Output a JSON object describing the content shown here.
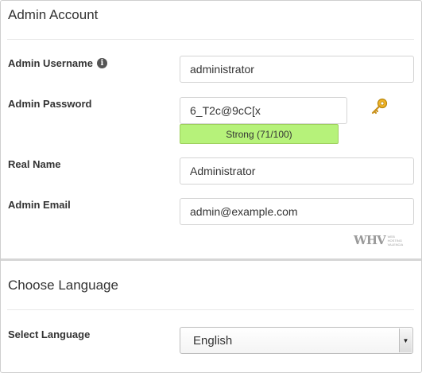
{
  "admin_section": {
    "title": "Admin Account",
    "username": {
      "label": "Admin Username",
      "value": "administrator"
    },
    "password": {
      "label": "Admin Password",
      "value": "6_T2c@9cC[x",
      "strength": "Strong (71/100)",
      "strength_color": "#b6f27a"
    },
    "real_name": {
      "label": "Real Name",
      "value": "Administrator"
    },
    "email": {
      "label": "Admin Email",
      "value": "admin@example.com"
    },
    "info_icon": "info-icon",
    "key_icon": "key-icon",
    "watermark": {
      "logo": "WHV",
      "sub_lines": [
        "WEB",
        "HOSTING",
        "VALENCIA"
      ]
    }
  },
  "language_section": {
    "title": "Choose Language",
    "select_label": "Select Language",
    "selected": "English"
  }
}
